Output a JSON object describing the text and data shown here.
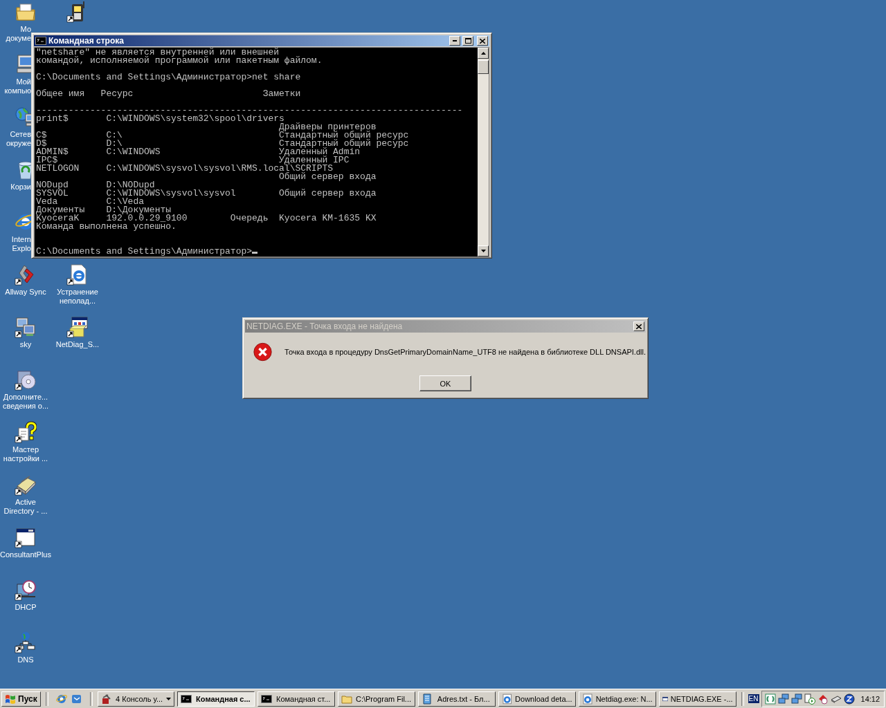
{
  "desktop_icons": [
    {
      "kind": "documents",
      "shortcut": false,
      "label": [
        "Мо",
        "докуме"
      ]
    },
    {
      "kind": "computer",
      "shortcut": false,
      "label": [
        "Мой",
        "компью"
      ]
    },
    {
      "kind": "network",
      "shortcut": false,
      "label": [
        "Сетев",
        "окруже"
      ]
    },
    {
      "kind": "recycle",
      "shortcut": false,
      "label": [
        "Корзи"
      ]
    },
    {
      "kind": "ie",
      "shortcut": false,
      "label": [
        "Intern",
        "Explo"
      ]
    },
    {
      "kind": "allway",
      "shortcut": true,
      "label": [
        "Allway Sync"
      ]
    },
    {
      "kind": "sky",
      "shortcut": true,
      "label": [
        "sky"
      ]
    },
    {
      "kind": "cd",
      "shortcut": true,
      "label": [
        "Дополните...",
        "сведения о..."
      ]
    },
    {
      "kind": "help",
      "shortcut": true,
      "label": [
        "Мастер",
        "настройки ..."
      ]
    },
    {
      "kind": "printer",
      "shortcut": true,
      "label": [
        "Active",
        "Directory - ..."
      ]
    },
    {
      "kind": "window",
      "shortcut": true,
      "label": [
        "ConsultantPlus"
      ]
    },
    {
      "kind": "dhcp",
      "shortcut": true,
      "label": [
        "DHCP"
      ]
    },
    {
      "kind": "dns",
      "shortcut": true,
      "label": [
        "DNS"
      ]
    },
    {
      "kind": "phone",
      "shortcut": true
    },
    {
      "kind": "iedoc",
      "shortcut": true,
      "label": [
        "Устранение",
        "неполад..."
      ]
    },
    {
      "kind": "netdiag",
      "shortcut": true,
      "label": [
        "NetDiag_S..."
      ]
    }
  ],
  "console_window": {
    "title": "Командная строка",
    "active": true,
    "lines": [
      {
        "kind": "text",
        "text": "\"netshare\" не является внутренней или внешней"
      },
      {
        "kind": "text",
        "text": "командой, исполняемой программой или пакетным файлом."
      },
      {
        "kind": "blank"
      },
      {
        "kind": "text",
        "text": "C:\\Documents and Settings\\Администратор>net share"
      },
      {
        "kind": "blank"
      },
      {
        "kind": "text",
        "text": "Общее имя   Ресурс                        Заметки"
      },
      {
        "kind": "blank"
      },
      {
        "kind": "text",
        "text": "-------------------------------------------------------------------------------"
      },
      {
        "kind": "share",
        "name": "print$",
        "path": "C:\\WINDOWS\\system32\\spool\\drivers"
      },
      {
        "kind": "share",
        "remark": "Драйверы принтеров"
      },
      {
        "kind": "share",
        "name": "C$",
        "path": "C:\\",
        "remark": "Стандартный общий ресурс"
      },
      {
        "kind": "share",
        "name": "D$",
        "path": "D:\\",
        "remark": "Стандартный общий ресурс"
      },
      {
        "kind": "share",
        "name": "ADMIN$",
        "path": "C:\\WINDOWS",
        "remark": "Удаленный Admin"
      },
      {
        "kind": "share",
        "name": "IPC$",
        "remark": "Удаленный IPC"
      },
      {
        "kind": "share",
        "name": "NETLOGON",
        "path": "C:\\WINDOWS\\sysvol\\sysvol\\RMS.local\\SCRIPTS"
      },
      {
        "kind": "share",
        "remark": "Общий сервер входа"
      },
      {
        "kind": "share",
        "name": "NODupd",
        "path": "D:\\NODupd"
      },
      {
        "kind": "share",
        "name": "SYSVOL",
        "path": "C:\\WINDOWS\\sysvol\\sysvol",
        "remark": "Общий сервер входа"
      },
      {
        "kind": "share",
        "name": "Veda",
        "path": "C:\\Veda"
      },
      {
        "kind": "share",
        "name": "Документы",
        "path": "D:\\Документы"
      },
      {
        "kind": "share",
        "name": "KyoceraK",
        "path": "192.0.0.29_9100",
        "type": "Очередь",
        "remark": "Kyocera KM-1635 KX"
      },
      {
        "kind": "text",
        "text": "Команда выполнена успешно."
      },
      {
        "kind": "blank"
      },
      {
        "kind": "blank"
      },
      {
        "kind": "prompt",
        "text": "C:\\Documents and Settings\\Администратор>"
      }
    ]
  },
  "error_dialog": {
    "title": "NETDIAG.EXE - Точка входа не найдена",
    "active": false,
    "message": "Точка входа в процедуру DnsGetPrimaryDomainName_UTF8 не найдена в библиотеке DLL DNSAPI.dll.",
    "buttons": [
      "OK"
    ]
  },
  "taskbar": {
    "start": "Пуск",
    "tasks": [
      {
        "kind": "console",
        "label": "4 Консоль у...",
        "group": true,
        "selected": false
      },
      {
        "kind": "cmd",
        "label": "Командная с...",
        "selected": true
      },
      {
        "kind": "cmd",
        "label": "Командная ст...",
        "selected": false
      },
      {
        "kind": "folder",
        "label": "C:\\Program Fil...",
        "selected": false
      },
      {
        "kind": "notepad",
        "label": "Adres.txt - Бл...",
        "selected": false
      },
      {
        "kind": "ie",
        "label": "Download deta...",
        "selected": false
      },
      {
        "kind": "ie",
        "label": "Netdiag.exe: N...",
        "selected": false
      },
      {
        "kind": "window",
        "label": "NETDIAG.EXE -...",
        "selected": false
      }
    ],
    "language": "EN",
    "clock": "14:12"
  }
}
